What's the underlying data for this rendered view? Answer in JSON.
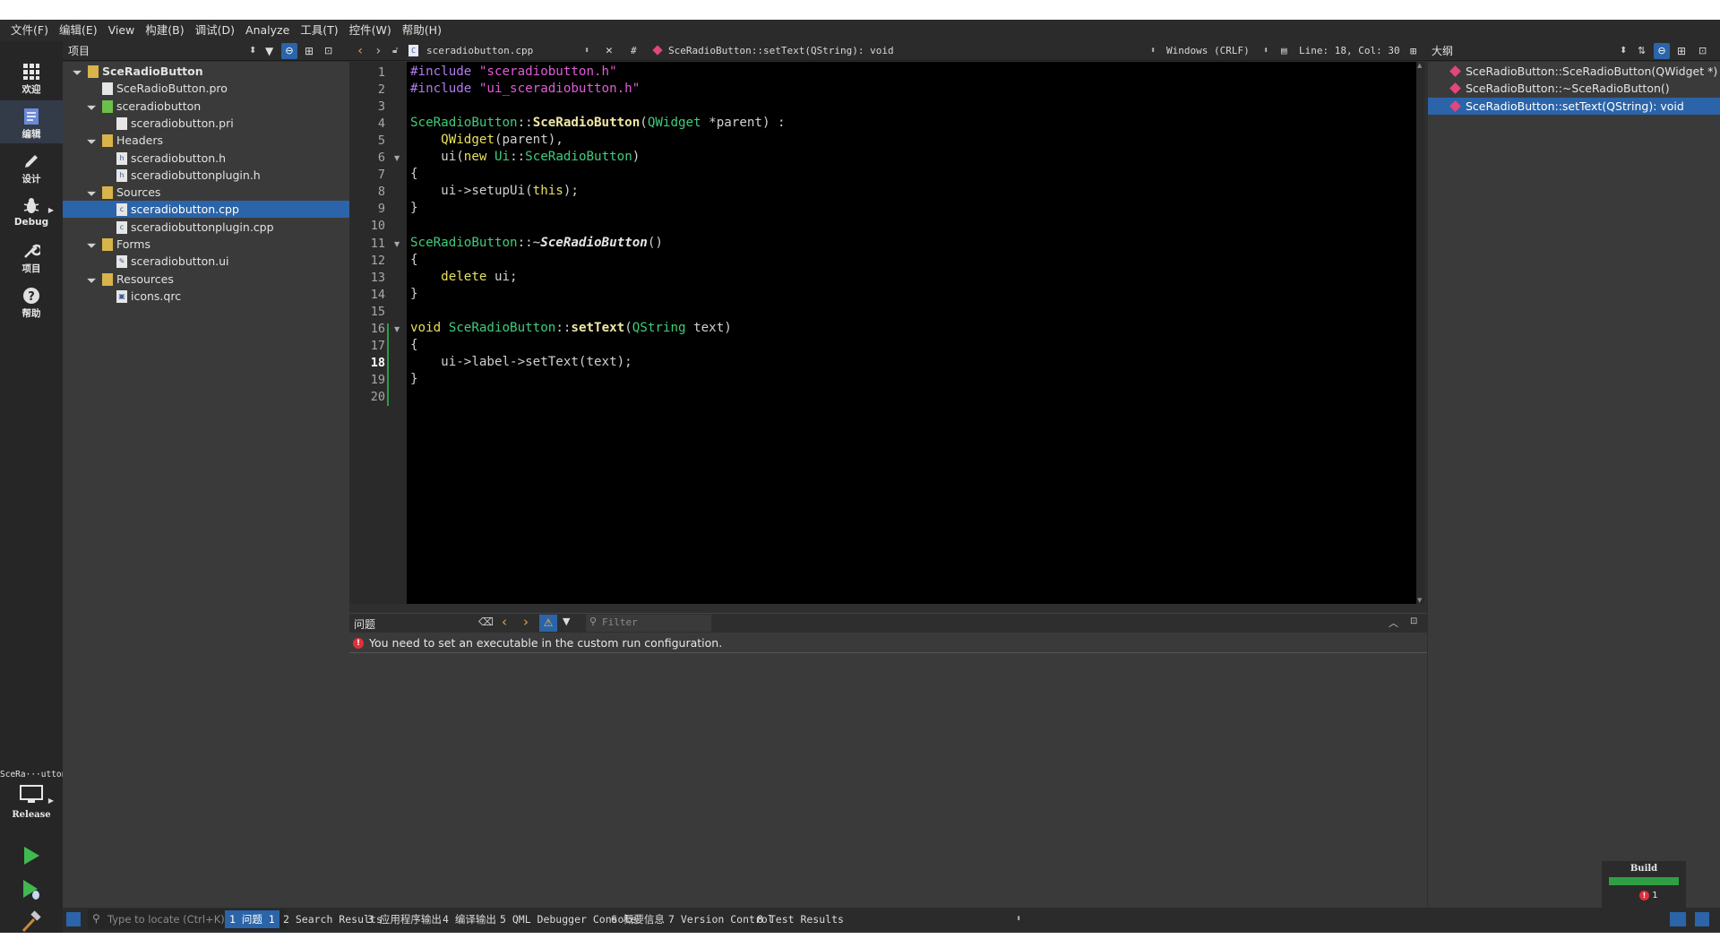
{
  "menu": [
    "文件(F)",
    "编辑(E)",
    "View",
    "构建(B)",
    "调试(D)",
    "Analyze",
    "工具(T)",
    "控件(W)",
    "帮助(H)"
  ],
  "modes": [
    {
      "label": "欢迎",
      "icon": "grid-icon"
    },
    {
      "label": "编辑",
      "icon": "edit-icon"
    },
    {
      "label": "设计",
      "icon": "pencil-icon"
    },
    {
      "label": "Debug",
      "icon": "bug-icon"
    },
    {
      "label": "项目",
      "icon": "wrench-icon"
    },
    {
      "label": "帮助",
      "icon": "help-icon"
    }
  ],
  "kit": {
    "project": "SceRa···utton",
    "config": "Release"
  },
  "project_panel": {
    "title": "项目",
    "tree": [
      {
        "label": "SceRadioButton",
        "depth": 0,
        "type": "project",
        "expanded": true,
        "bold": true
      },
      {
        "label": "SceRadioButton.pro",
        "depth": 1,
        "type": "pro"
      },
      {
        "label": "sceradiobutton",
        "depth": 1,
        "type": "folder-green",
        "expanded": true
      },
      {
        "label": "sceradiobutton.pri",
        "depth": 2,
        "type": "pro"
      },
      {
        "label": "Headers",
        "depth": 1,
        "type": "folder",
        "expanded": true
      },
      {
        "label": "sceradiobutton.h",
        "depth": 2,
        "type": "header"
      },
      {
        "label": "sceradiobuttonplugin.h",
        "depth": 2,
        "type": "header"
      },
      {
        "label": "Sources",
        "depth": 1,
        "type": "folder",
        "expanded": true
      },
      {
        "label": "sceradiobutton.cpp",
        "depth": 2,
        "type": "cpp",
        "selected": true
      },
      {
        "label": "sceradiobuttonplugin.cpp",
        "depth": 2,
        "type": "cpp"
      },
      {
        "label": "Forms",
        "depth": 1,
        "type": "folder",
        "expanded": true
      },
      {
        "label": "sceradiobutton.ui",
        "depth": 2,
        "type": "ui"
      },
      {
        "label": "Resources",
        "depth": 1,
        "type": "folder",
        "expanded": true
      },
      {
        "label": "icons.qrc",
        "depth": 2,
        "type": "qrc"
      }
    ]
  },
  "editor_toolbar": {
    "file": "sceradiobutton.cpp",
    "hash": "#",
    "symbol": "SceRadioButton::setText(QString): void",
    "encoding": "Windows (CRLF)",
    "position": "Line: 18, Col: 30"
  },
  "editor": {
    "current_line": 18,
    "fold_lines": [
      6,
      11,
      16
    ],
    "lines": [
      [
        [
          "kw-pp",
          "#include "
        ],
        [
          "str",
          "\"sceradiobutton.h\""
        ]
      ],
      [
        [
          "kw-pp",
          "#include "
        ],
        [
          "str",
          "\"ui_sceradiobutton.h\""
        ]
      ],
      [],
      [
        [
          "cls",
          "SceRadioButton"
        ],
        [
          "",
          "::"
        ],
        [
          "fn",
          "SceRadioButton"
        ],
        [
          "",
          "("
        ],
        [
          "cls",
          "QWidget"
        ],
        [
          "",
          " *parent) :"
        ]
      ],
      [
        [
          "",
          "    "
        ],
        [
          "kw",
          "QWidget"
        ],
        [
          "",
          "(parent),"
        ]
      ],
      [
        [
          "",
          "    ui("
        ],
        [
          "kw",
          "new"
        ],
        [
          "",
          " "
        ],
        [
          "cls",
          "Ui"
        ],
        [
          "",
          "::"
        ],
        [
          "cls",
          "SceRadioButton"
        ],
        [
          "",
          ")"
        ]
      ],
      [
        [
          "",
          "{"
        ]
      ],
      [
        [
          "",
          "    ui->setupUi("
        ],
        [
          "kw",
          "this"
        ],
        [
          "",
          ");"
        ]
      ],
      [
        [
          "",
          "}"
        ]
      ],
      [],
      [
        [
          "cls",
          "SceRadioButton"
        ],
        [
          "",
          "::~"
        ],
        [
          "it",
          "SceRadioButton"
        ],
        [
          "",
          "()"
        ]
      ],
      [
        [
          "",
          "{"
        ]
      ],
      [
        [
          "",
          "    "
        ],
        [
          "kw",
          "delete"
        ],
        [
          "",
          " ui;"
        ]
      ],
      [
        [
          "",
          "}"
        ]
      ],
      [],
      [
        [
          "kw",
          "void"
        ],
        [
          "",
          " "
        ],
        [
          "cls",
          "SceRadioButton"
        ],
        [
          "",
          "::"
        ],
        [
          "fn",
          "setText"
        ],
        [
          "",
          "("
        ],
        [
          "cls",
          "QString"
        ],
        [
          "",
          " text)"
        ]
      ],
      [
        [
          "",
          "{"
        ]
      ],
      [
        [
          "",
          "    ui->label->setText(text);"
        ]
      ],
      [
        [
          "",
          "}"
        ]
      ],
      []
    ]
  },
  "outline": {
    "title": "大纲",
    "items": [
      {
        "label": "SceRadioButton::SceRadioButton(QWidget *)"
      },
      {
        "label": "SceRadioButton::~SceRadioButton()"
      },
      {
        "label": "SceRadioButton::setText(QString): void",
        "selected": true
      }
    ]
  },
  "issues": {
    "title": "问题",
    "filter_placeholder": "Filter",
    "items": [
      {
        "text": "You need to set an executable in the custom run configuration.",
        "severity": "error"
      }
    ]
  },
  "statusbar": {
    "locate_placeholder": "Type to locate (Ctrl+K)",
    "tabs": [
      "1  问题  1",
      "2  Search Results",
      "3  应用程序输出",
      "4  编译输出",
      "5  QML Debugger Console",
      "6  概要信息",
      "7  Version Control",
      "8  Test Results"
    ]
  },
  "build_widget": {
    "title": "Build",
    "errors": "1"
  },
  "colors": {
    "selection": "#2b64a8",
    "editor_bg": "#000000",
    "panel_bg": "#3a3a3a",
    "build_ok": "#2ea043",
    "error": "#e0303a"
  }
}
